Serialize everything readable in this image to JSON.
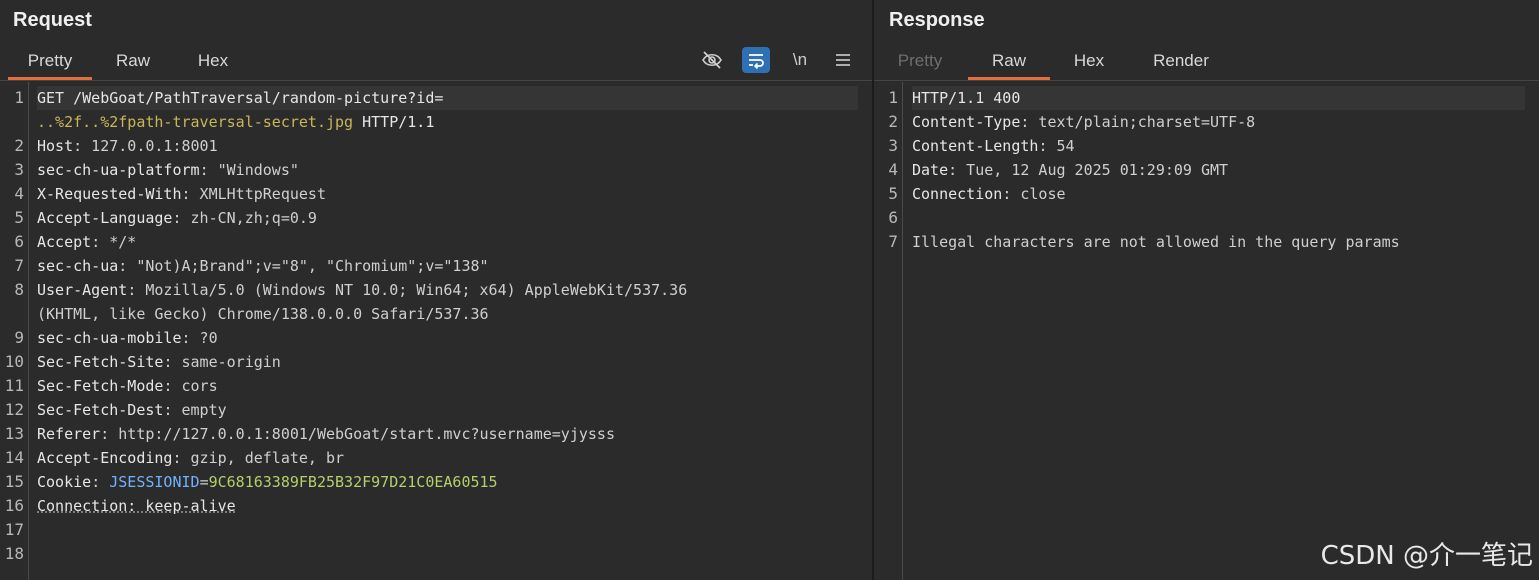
{
  "request": {
    "title": "Request",
    "tabs": [
      "Pretty",
      "Raw",
      "Hex"
    ],
    "active_tab": "Pretty",
    "toolbar": {
      "hide_icon": "eye-slash-icon",
      "wrap_icon": "wrap-lines-icon",
      "newline_label": "\\n",
      "menu_icon": "hamburger-menu-icon"
    },
    "line_numbers": [
      "1",
      "2",
      "3",
      "4",
      "5",
      "6",
      "7",
      "8",
      "9",
      "10",
      "11",
      "12",
      "13",
      "14",
      "15",
      "16",
      "17",
      "18"
    ],
    "lines": {
      "l1a": "GET /WebGoat/PathTraversal/random-picture?id=",
      "l1b": "..%2f..%2fpath-traversal-secret.jpg",
      "l1c": " HTTP/1.1",
      "l2k": "Host",
      "l2v": ": 127.0.0.1:8001",
      "l3k": "sec-ch-ua-platform",
      "l3v": ": \"Windows\"",
      "l4k": "X-Requested-With",
      "l4v": ": XMLHttpRequest",
      "l5k": "Accept-Language",
      "l5v": ": zh-CN,zh;q=0.9",
      "l6k": "Accept",
      "l6v": ": */*",
      "l7k": "sec-ch-ua",
      "l7v": ": \"Not)A;Brand\";v=\"8\", \"Chromium\";v=\"138\"",
      "l8k": "User-Agent",
      "l8v": ": Mozilla/5.0 (Windows NT 10.0; Win64; x64) AppleWebKit/537.36",
      "l8b": "(KHTML, like Gecko) Chrome/138.0.0.0 Safari/537.36",
      "l9k": "sec-ch-ua-mobile",
      "l9v": ": ?0",
      "l10k": "Sec-Fetch-Site",
      "l10v": ": same-origin",
      "l11k": "Sec-Fetch-Mode",
      "l11v": ": cors",
      "l12k": "Sec-Fetch-Dest",
      "l12v": ": empty",
      "l13k": "Referer",
      "l13v": ": http://127.0.0.1:8001/WebGoat/start.mvc?username=yjysss",
      "l14k": "Accept-Encoding",
      "l14v": ": gzip, deflate, br",
      "l15k": "Cookie",
      "l15s": ": ",
      "l15n": "JSESSIONID",
      "l15e": "=",
      "l15val": "9C68163389FB25B32F97D21C0EA60515",
      "l16": "Connection: keep-alive"
    }
  },
  "response": {
    "title": "Response",
    "tabs": [
      "Pretty",
      "Raw",
      "Hex",
      "Render"
    ],
    "active_tab": "Raw",
    "line_numbers": [
      "1",
      "2",
      "3",
      "4",
      "5",
      "6",
      "7"
    ],
    "lines": {
      "l1": "HTTP/1.1 400",
      "l2k": "Content-Type",
      "l2v": ": text/plain;charset=UTF-8",
      "l3k": "Content-Length",
      "l3v": ": 54",
      "l4k": "Date",
      "l4v": ": Tue, 12 Aug 2025 01:29:09 GMT",
      "l5k": "Connection",
      "l5v": ": close",
      "l7": "Illegal characters are not allowed in the query params"
    }
  },
  "watermark": "CSDN @介一笔记",
  "colors": {
    "accent": "#e3703a",
    "background": "#2b2b2b",
    "wrap_button": "#2f6fb4",
    "cookie_name": "#6fb3ff",
    "cookie_value": "#b5cf6b",
    "url_param": "#c9b55a"
  }
}
